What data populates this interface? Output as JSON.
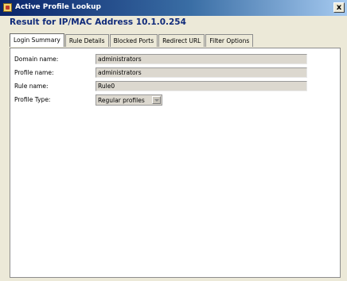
{
  "window": {
    "title": "Active Profile Lookup",
    "close_glyph": "x"
  },
  "heading": "Result for IP/MAC Address 10.1.0.254",
  "tabs": [
    {
      "label": "Login Summary",
      "active": true
    },
    {
      "label": "Rule Details",
      "active": false
    },
    {
      "label": "Blocked Ports",
      "active": false
    },
    {
      "label": "Redirect URL",
      "active": false
    },
    {
      "label": "Filter Options",
      "active": false
    }
  ],
  "fields": {
    "domain": {
      "label": "Domain name:",
      "value": "administrators"
    },
    "profile": {
      "label": "Profile name:",
      "value": "administrators"
    },
    "rule": {
      "label": "Rule name:",
      "value": "Rule0"
    },
    "profile_type": {
      "label": "Profile Type:",
      "value": "Regular profiles"
    }
  },
  "icons": {
    "app": "profile-lookup-icon",
    "close": "close-icon",
    "dropdown": "chevron-down-icon"
  },
  "colors": {
    "titlebar": "#0a246a",
    "heading": "#0f2a7a",
    "field_bg": "#dcd8cf"
  }
}
